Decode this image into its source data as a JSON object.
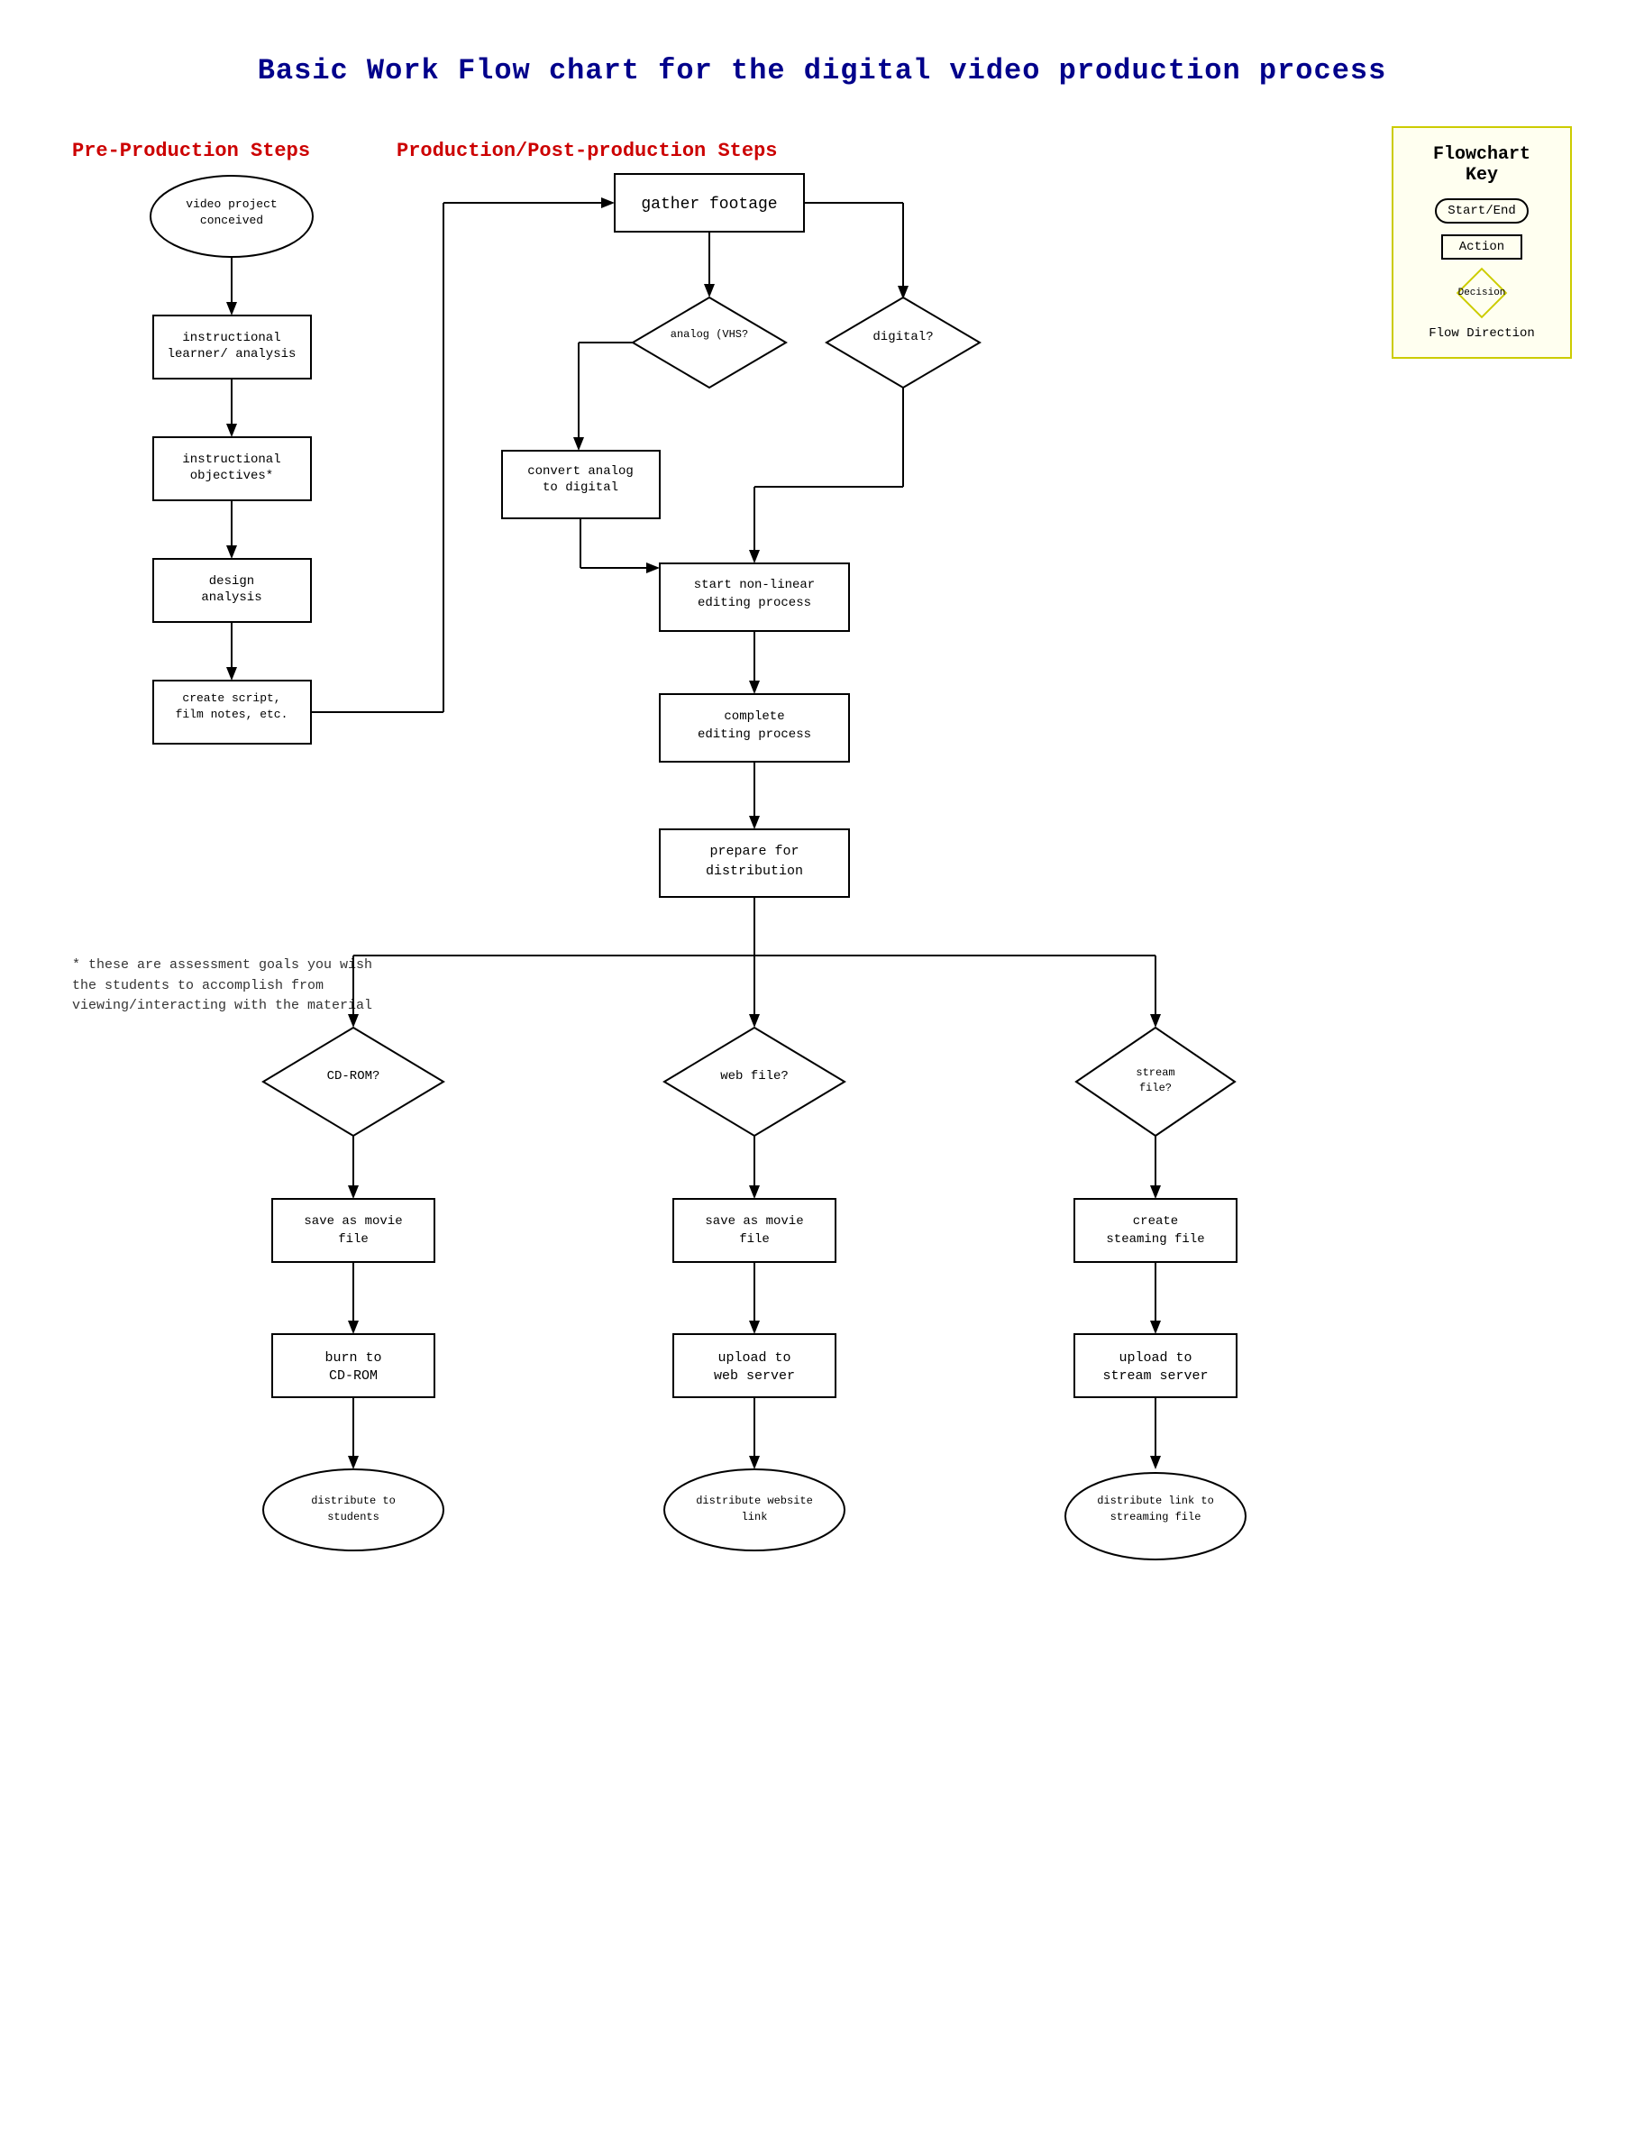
{
  "title": "Basic Work Flow chart for the digital video production process",
  "sections": {
    "preproduction": "Pre-Production Steps",
    "production": "Production/Post-production Steps"
  },
  "key": {
    "title": "Flowchart Key",
    "startend": "Start/End",
    "action": "Action",
    "decision": "Decision",
    "flow": "Flow Direction"
  },
  "footnote": "* these are assessment goals you wish the students to accomplish from viewing/interacting with the material",
  "nodes": {
    "videoProjectConceived": "video project conceived",
    "instructionalLearner": "instructional learner/ analysis",
    "instructionalObjectives": "instructional objectives*",
    "designAnalysis": "design analysis",
    "createScript": "create script, film notes, etc.",
    "gatherFootage": "gather footage",
    "analogVHS": "analog (VHS?",
    "digital": "digital?",
    "convertAnalog": "convert analog to digital",
    "startNonLinear": "start non-linear editing process",
    "completeEditing": "complete editing process",
    "prepareDistribution": "prepare for distribution",
    "cdrom": "CD-ROM?",
    "webFile": "web file?",
    "streamFile": "stream file?",
    "saveMovieCDROM": "save as movie file",
    "saveMovieWeb": "save as movie file",
    "createStreaming": "create steaming file",
    "burnCDROM": "burn to CD-ROM",
    "uploadWebServer": "upload to web server",
    "uploadStreamServer": "upload to stream server",
    "distributeStudents": "distribute to students",
    "distributeWebsite": "distribute website link",
    "distributeLinkStreaming": "distribute link to streaming file"
  }
}
